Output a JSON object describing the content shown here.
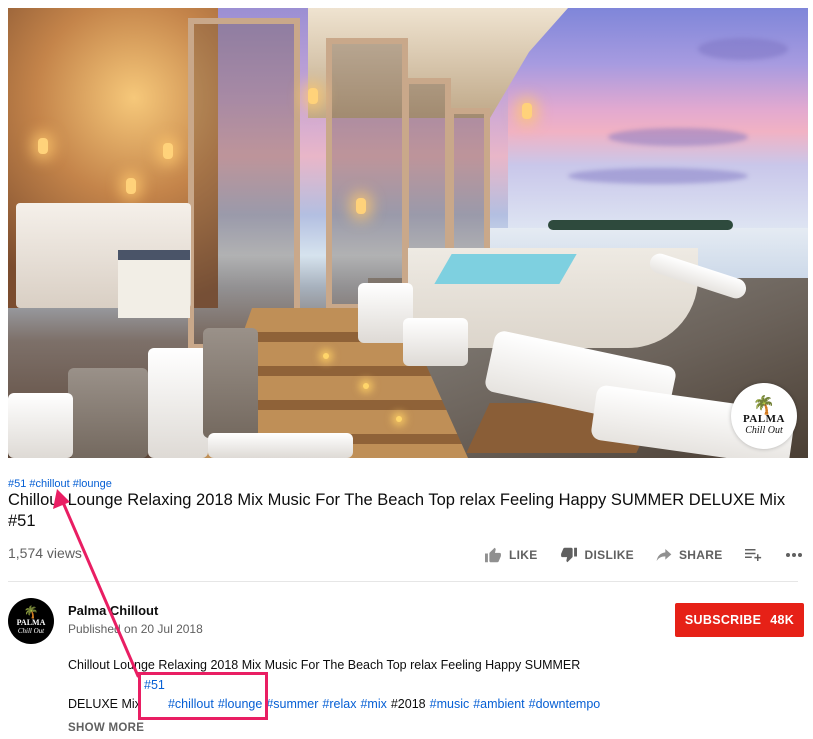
{
  "video": {
    "watermark": {
      "line1": "PALMA",
      "line2": "Chill Out"
    }
  },
  "hashtags_top": [
    "#51",
    "#chillout",
    "#lounge"
  ],
  "title": "Chillout Lounge Relaxing 2018 Mix Music For The Beach Top relax Feeling Happy SUMMER DELUXE Mix #51",
  "views": "1,574 views",
  "actions": {
    "like": "LIKE",
    "dislike": "DISLIKE",
    "share": "SHARE"
  },
  "icons": {
    "like": "thumbs-up-icon",
    "dislike": "thumbs-down-icon",
    "share": "share-arrow-icon",
    "add_to_playlist": "playlist-add-icon",
    "more": "more-horizontal-icon"
  },
  "channel": {
    "name": "Palma Chillout",
    "published": "Published on 20 Jul 2018",
    "avatar": {
      "line1": "PALMA",
      "line2": "Chill Out"
    }
  },
  "subscribe": {
    "label": "SUBSCRIBE",
    "count": "48K"
  },
  "description": {
    "line1": "Chillout Lounge Relaxing 2018 Mix Music For The Beach Top relax Feeling Happy SUMMER",
    "tag_51": "#51",
    "line2_prefix": "DELUXE Mix",
    "line2_tags": [
      "#chillout",
      "#lounge",
      "#summer",
      "#relax",
      "#mix"
    ],
    "line2_plain": "#2018",
    "line2_tags_after": [
      "#music",
      "#ambient",
      "#downtempo"
    ],
    "show_more": "SHOW MORE"
  },
  "colors": {
    "link": "#065fd4",
    "subscribe_bg": "#e62117",
    "annotation": "#e91e63"
  }
}
